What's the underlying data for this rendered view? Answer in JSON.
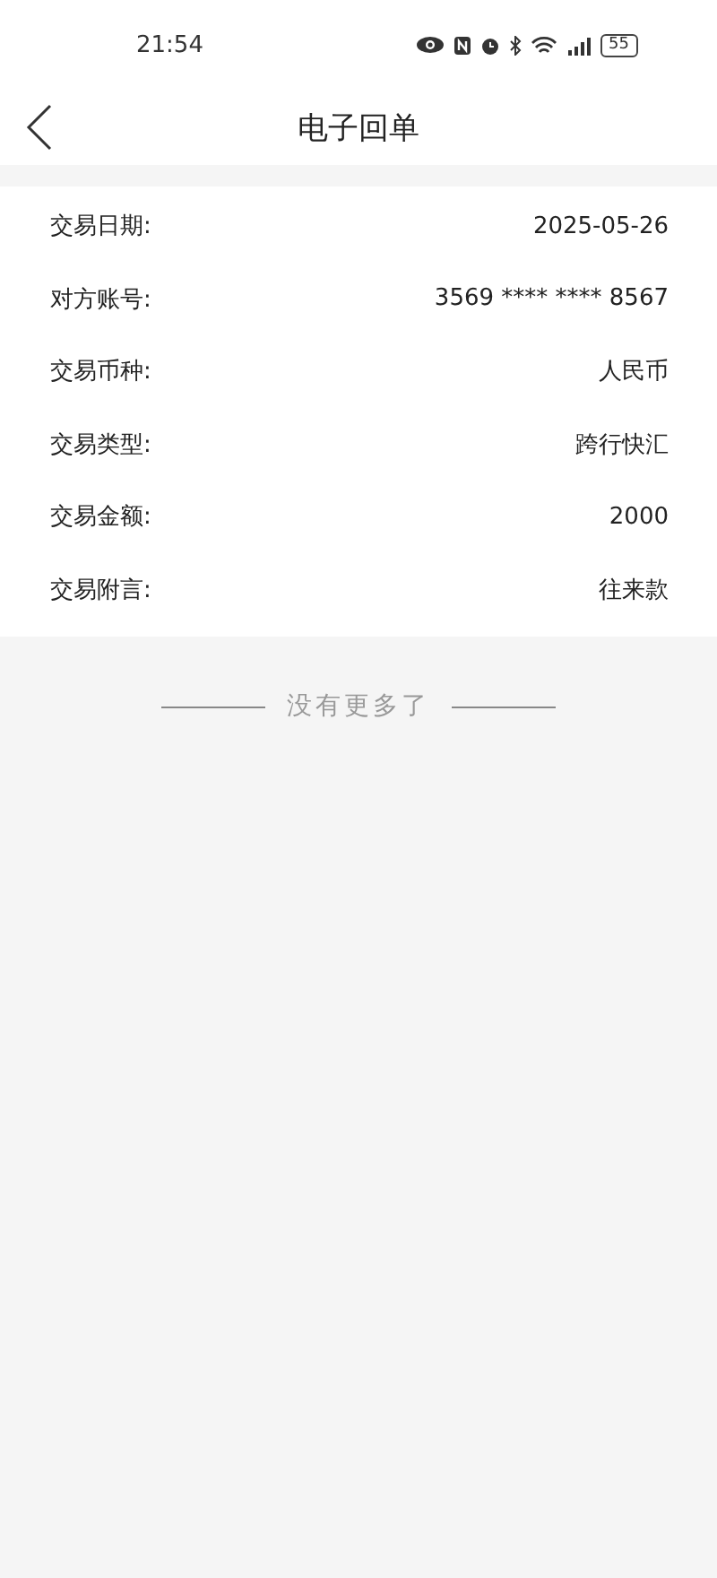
{
  "status_bar": {
    "time": "21:54",
    "battery": "55"
  },
  "header": {
    "title": "电子回单"
  },
  "details": [
    {
      "label": "交易日期:",
      "value": "2025-05-26"
    },
    {
      "label": "对方账号:",
      "value": "3569 **** **** 8567"
    },
    {
      "label": "交易币种:",
      "value": "人民币"
    },
    {
      "label": "交易类型:",
      "value": "跨行快汇"
    },
    {
      "label": "交易金额:",
      "value": "2000"
    },
    {
      "label": "交易附言:",
      "value": "往来款"
    }
  ],
  "footer": {
    "text": "没有更多了"
  }
}
